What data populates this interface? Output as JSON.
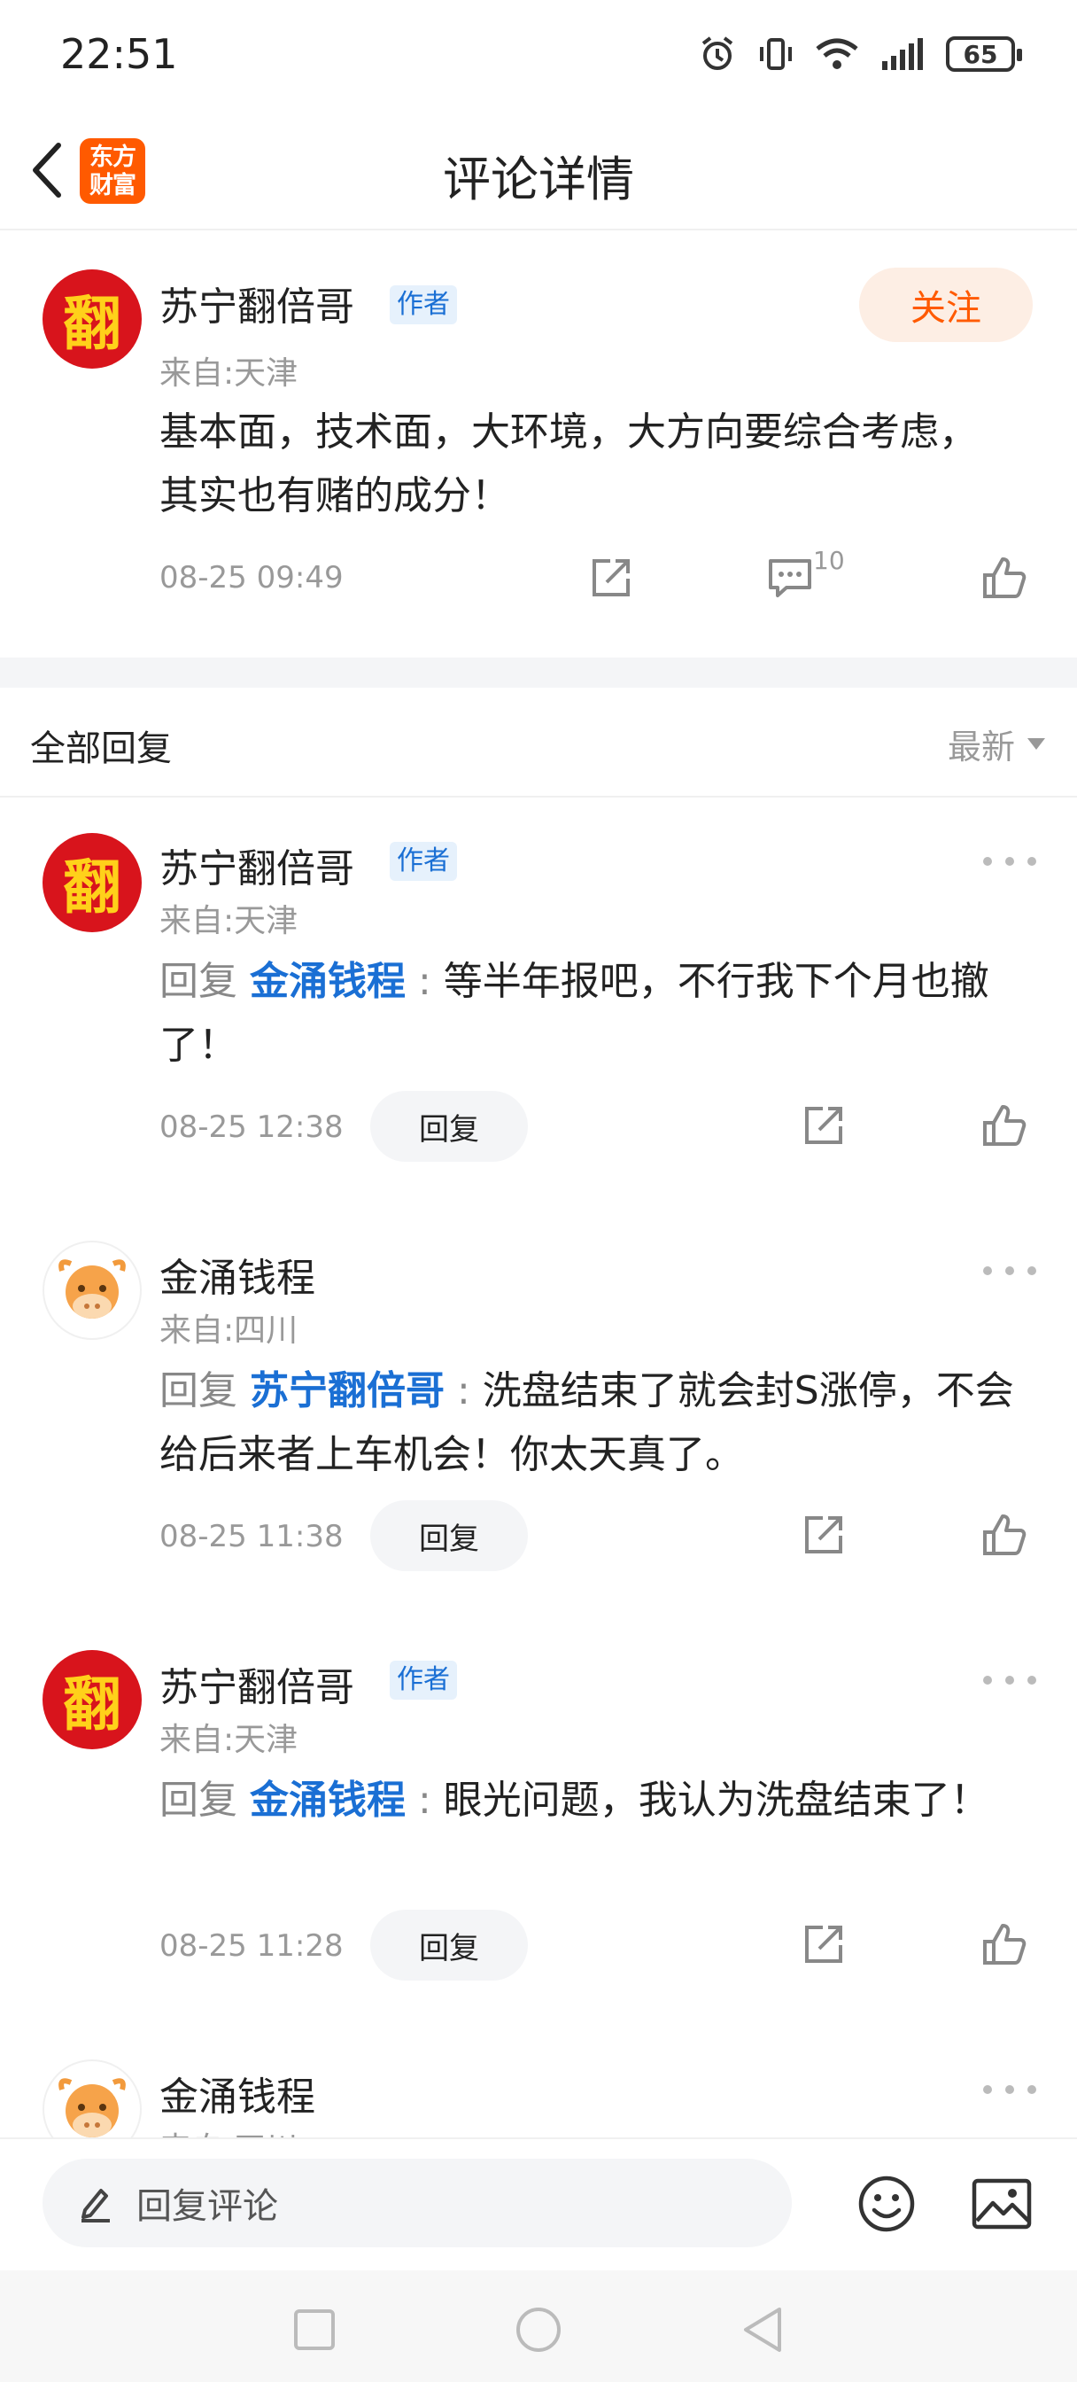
{
  "status_bar": {
    "time": "22:51",
    "battery": "65"
  },
  "header": {
    "title": "评论详情",
    "logo_text": "东方财富"
  },
  "main_comment": {
    "avatar_char": "翻",
    "username": "苏宁翻倍哥",
    "badge": "作者",
    "location": "来自:天津",
    "follow_label": "关注",
    "text": "基本面，技术面，大环境，大方向要综合考虑，其实也有赌的成分！",
    "time": "08-25 09:49",
    "reply_count": "10"
  },
  "replies_section": {
    "title": "全部回复",
    "sort_label": "最新"
  },
  "replies": [
    {
      "avatar_char": "翻",
      "username": "苏宁翻倍哥",
      "badge": "作者",
      "location": "来自:天津",
      "prefix": "回复 ",
      "target": "金涌钱程",
      "colon": " : ",
      "text": "等半年报吧，不行我下个月也撤了！",
      "time": "08-25 12:38",
      "reply_label": "回复"
    },
    {
      "avatar_char": "",
      "username": "金涌钱程",
      "badge": "",
      "location": "来自:四川",
      "prefix": "回复 ",
      "target": "苏宁翻倍哥",
      "colon": " : ",
      "text": "洗盘结束了就会封S涨停，不会给后来者上车机会！你太天真了。",
      "time": "08-25 11:38",
      "reply_label": "回复"
    },
    {
      "avatar_char": "翻",
      "username": "苏宁翻倍哥",
      "badge": "作者",
      "location": "来自:天津",
      "prefix": "回复 ",
      "target": "金涌钱程",
      "colon": " : ",
      "text": "眼光问题，我认为洗盘结束了！",
      "time": "08-25 11:28",
      "reply_label": "回复"
    },
    {
      "avatar_char": "",
      "username": "金涌钱程",
      "location": "来自:四川"
    }
  ],
  "bottom_bar": {
    "input_placeholder": "回复评论"
  },
  "colors": {
    "brand_orange": "#ff5a00",
    "link_blue": "#1a6fd4",
    "avatar_red": "#d8141c"
  },
  "icons": [
    "alarm-icon",
    "vibrate-icon",
    "wifi-icon",
    "signal-icon",
    "battery-icon",
    "back-arrow-icon",
    "share-icon",
    "comment-icon",
    "like-icon",
    "more-icon",
    "pencil-icon",
    "emoji-icon",
    "image-icon",
    "nav-square-icon",
    "nav-circle-icon",
    "nav-back-icon"
  ]
}
